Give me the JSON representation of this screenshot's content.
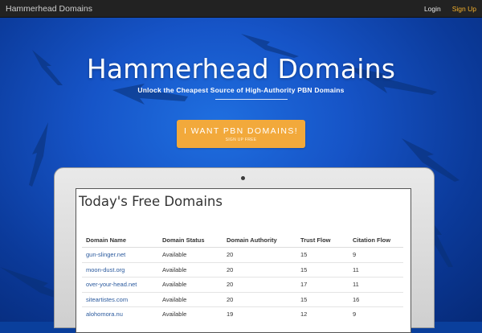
{
  "navbar": {
    "brand": "Hammerhead Domains",
    "login": "Login",
    "signup": "Sign Up"
  },
  "hero": {
    "title": "Hammerhead Domains",
    "subtitle": "Unlock the Cheapest Source of High-Authority PBN Domains",
    "cta_label": "I WANT PBN DOMAINS!",
    "cta_sub": "SIGN UP FREE"
  },
  "table": {
    "title": "Today's Free Domains",
    "headers": [
      "Domain Name",
      "Domain Status",
      "Domain Authority",
      "Trust Flow",
      "Citation Flow"
    ],
    "rows": [
      [
        "gun-slinger.net",
        "Available",
        "20",
        "15",
        "9"
      ],
      [
        "moon-dust.org",
        "Available",
        "20",
        "15",
        "11"
      ],
      [
        "over-your-head.net",
        "Available",
        "20",
        "17",
        "11"
      ],
      [
        "siteartistes.com",
        "Available",
        "20",
        "15",
        "16"
      ],
      [
        "alohomora.nu",
        "Available",
        "19",
        "12",
        "9"
      ]
    ]
  },
  "colors": {
    "navbar": "#222222",
    "accent": "#f2a93b",
    "signup_link": "#f5b22e",
    "hero_blue": "#1654c7",
    "link": "#2b5a9e"
  },
  "icons": [
    "hammerhead-shark-silhouette",
    "laptop-camera-dot"
  ]
}
